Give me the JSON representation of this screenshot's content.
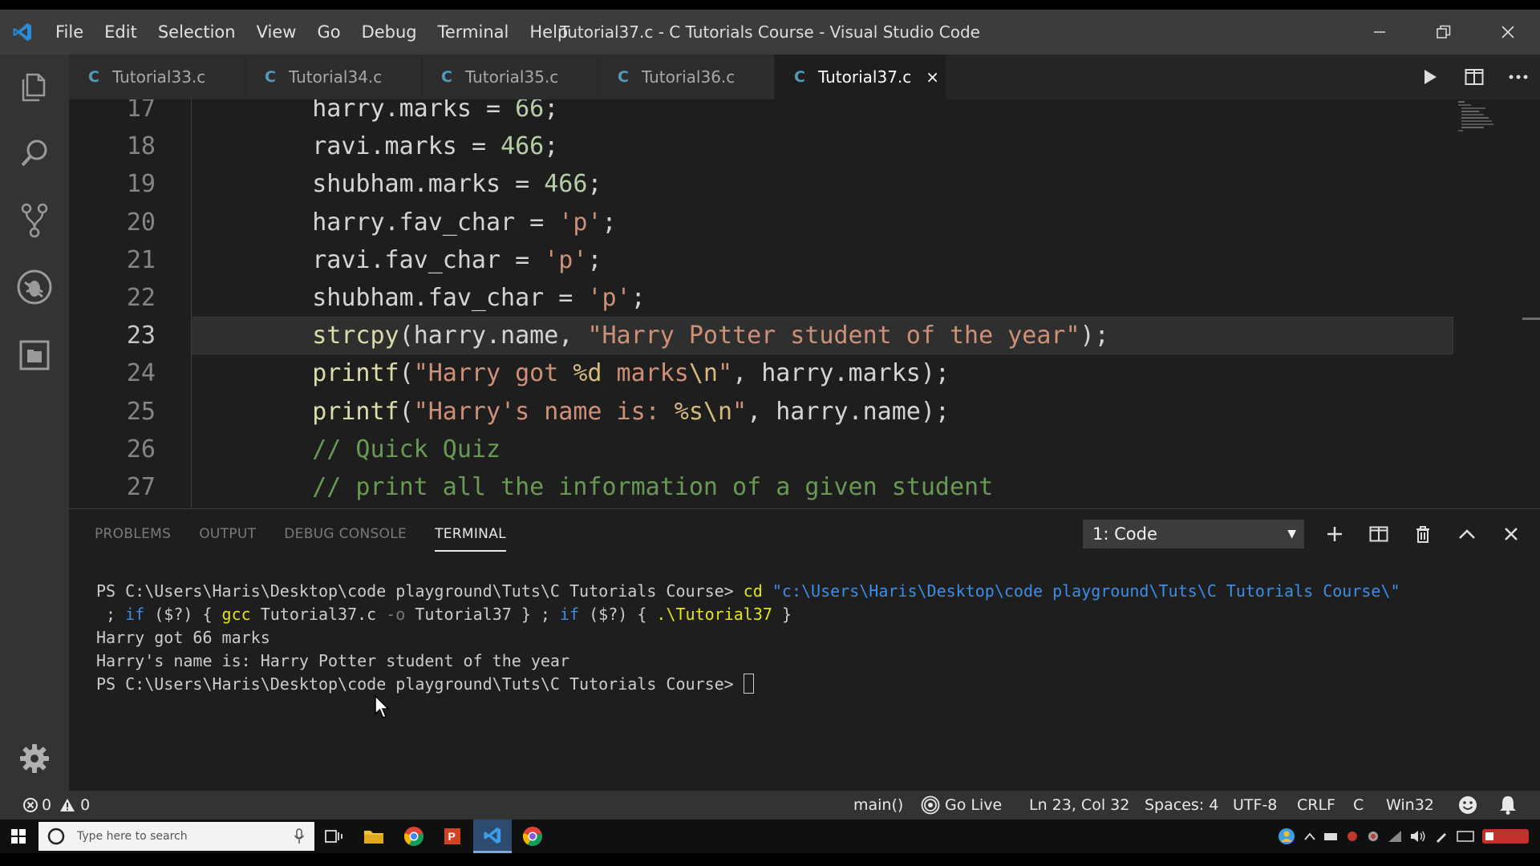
{
  "window": {
    "title": "Tutorial37.c - C Tutorials Course - Visual Studio Code",
    "app_logo": "vscode-logo-icon"
  },
  "menu": [
    "File",
    "Edit",
    "Selection",
    "View",
    "Go",
    "Debug",
    "Terminal",
    "Help"
  ],
  "tabs": [
    {
      "icon": "C",
      "label": "Tutorial33.c",
      "active": false
    },
    {
      "icon": "C",
      "label": "Tutorial34.c",
      "active": false
    },
    {
      "icon": "C",
      "label": "Tutorial35.c",
      "active": false
    },
    {
      "icon": "C",
      "label": "Tutorial36.c",
      "active": false
    },
    {
      "icon": "C",
      "label": "Tutorial37.c",
      "active": true,
      "close": "×"
    }
  ],
  "editor": {
    "current_line": 23,
    "lines": [
      {
        "n": "17",
        "tokens": [
          [
            "var",
            "    harry.marks "
          ],
          [
            "op",
            "= "
          ],
          [
            "num",
            "66"
          ],
          [
            "op",
            ";"
          ]
        ]
      },
      {
        "n": "18",
        "tokens": [
          [
            "var",
            "    ravi.marks "
          ],
          [
            "op",
            "= "
          ],
          [
            "num",
            "466"
          ],
          [
            "op",
            ";"
          ]
        ]
      },
      {
        "n": "19",
        "tokens": [
          [
            "var",
            "    shubham.marks "
          ],
          [
            "op",
            "= "
          ],
          [
            "num",
            "466"
          ],
          [
            "op",
            ";"
          ]
        ]
      },
      {
        "n": "20",
        "tokens": [
          [
            "var",
            "    harry.fav_char "
          ],
          [
            "op",
            "= "
          ],
          [
            "str",
            "'p'"
          ],
          [
            "op",
            ";"
          ]
        ]
      },
      {
        "n": "21",
        "tokens": [
          [
            "var",
            "    ravi.fav_char "
          ],
          [
            "op",
            "= "
          ],
          [
            "str",
            "'p'"
          ],
          [
            "op",
            ";"
          ]
        ]
      },
      {
        "n": "22",
        "tokens": [
          [
            "var",
            "    shubham.fav_char "
          ],
          [
            "op",
            "= "
          ],
          [
            "str",
            "'p'"
          ],
          [
            "op",
            ";"
          ]
        ]
      },
      {
        "n": "23",
        "tokens": [
          [
            "var",
            "    "
          ],
          [
            "fn",
            "strcpy"
          ],
          [
            "op",
            "("
          ],
          [
            "var",
            "harry.name, "
          ],
          [
            "str",
            "\"Harry Potter student of the year\""
          ],
          [
            "op",
            ");"
          ]
        ]
      },
      {
        "n": "24",
        "tokens": [
          [
            "var",
            "    "
          ],
          [
            "fn",
            "printf"
          ],
          [
            "op",
            "("
          ],
          [
            "str",
            "\"Harry got "
          ],
          [
            "esc",
            "%d"
          ],
          [
            "str",
            " marks"
          ],
          [
            "esc",
            "\\n"
          ],
          [
            "str",
            "\""
          ],
          [
            "op",
            ", "
          ],
          [
            "var",
            "harry.marks"
          ],
          [
            "op",
            ");"
          ]
        ]
      },
      {
        "n": "25",
        "tokens": [
          [
            "var",
            "    "
          ],
          [
            "fn",
            "printf"
          ],
          [
            "op",
            "("
          ],
          [
            "str",
            "\"Harry's name is: "
          ],
          [
            "esc",
            "%s"
          ],
          [
            "esc",
            "\\n"
          ],
          [
            "str",
            "\""
          ],
          [
            "op",
            ", "
          ],
          [
            "var",
            "harry.name"
          ],
          [
            "op",
            ");"
          ]
        ]
      },
      {
        "n": "26",
        "tokens": [
          [
            "var",
            "    "
          ],
          [
            "cmt",
            "// Quick Quiz"
          ]
        ]
      },
      {
        "n": "27",
        "tokens": [
          [
            "var",
            "    "
          ],
          [
            "cmt",
            "// print all the information of a given student"
          ]
        ]
      }
    ]
  },
  "panel": {
    "tabs": [
      {
        "label": "PROBLEMS",
        "active": false
      },
      {
        "label": "OUTPUT",
        "active": false
      },
      {
        "label": "DEBUG CONSOLE",
        "active": false
      },
      {
        "label": "TERMINAL",
        "active": true
      }
    ],
    "terminal_select": "1: Code",
    "terminal_lines": [
      [
        [
          "plain",
          "PS C:\\Users\\Haris\\Desktop\\code playground\\Tuts\\C Tutorials Course> "
        ],
        [
          "cmd",
          "cd "
        ],
        [
          "str",
          "\"c:\\Users\\Haris\\Desktop\\code playground\\Tuts\\C Tutorials Course\\\""
        ]
      ],
      [
        [
          "plain",
          " ; "
        ],
        [
          "kw",
          "if"
        ],
        [
          "plain",
          " ($?) { "
        ],
        [
          "cmd",
          "gcc"
        ],
        [
          "plain",
          " Tutorial37.c "
        ],
        [
          "param",
          "-o"
        ],
        [
          "plain",
          " Tutorial37 } ; "
        ],
        [
          "kw",
          "if"
        ],
        [
          "plain",
          " ($?) { "
        ],
        [
          "cmd",
          ".\\Tutorial37"
        ],
        [
          "plain",
          " }"
        ]
      ],
      [
        [
          "plain",
          "Harry got 66 marks"
        ]
      ],
      [
        [
          "plain",
          "Harry's name is: Harry Potter student of the year"
        ]
      ],
      [
        [
          "plain",
          "PS C:\\Users\\Haris\\Desktop\\code playground\\Tuts\\C Tutorials Course> "
        ]
      ]
    ]
  },
  "statusbar": {
    "errors": "0",
    "warnings": "0",
    "function": "main()",
    "go_live": "Go Live",
    "position": "Ln 23, Col 32",
    "spaces": "Spaces: 4",
    "encoding": "UTF-8",
    "eol": "CRLF",
    "language": "C",
    "platform": "Win32"
  },
  "taskbar": {
    "search_placeholder": "Type here to search"
  },
  "colors": {
    "accent_blue": "#007acc",
    "c_icon": "#519aba",
    "function": "#dcdcaa",
    "number": "#b5cea8",
    "string": "#ce9178",
    "comment": "#6a9955"
  }
}
